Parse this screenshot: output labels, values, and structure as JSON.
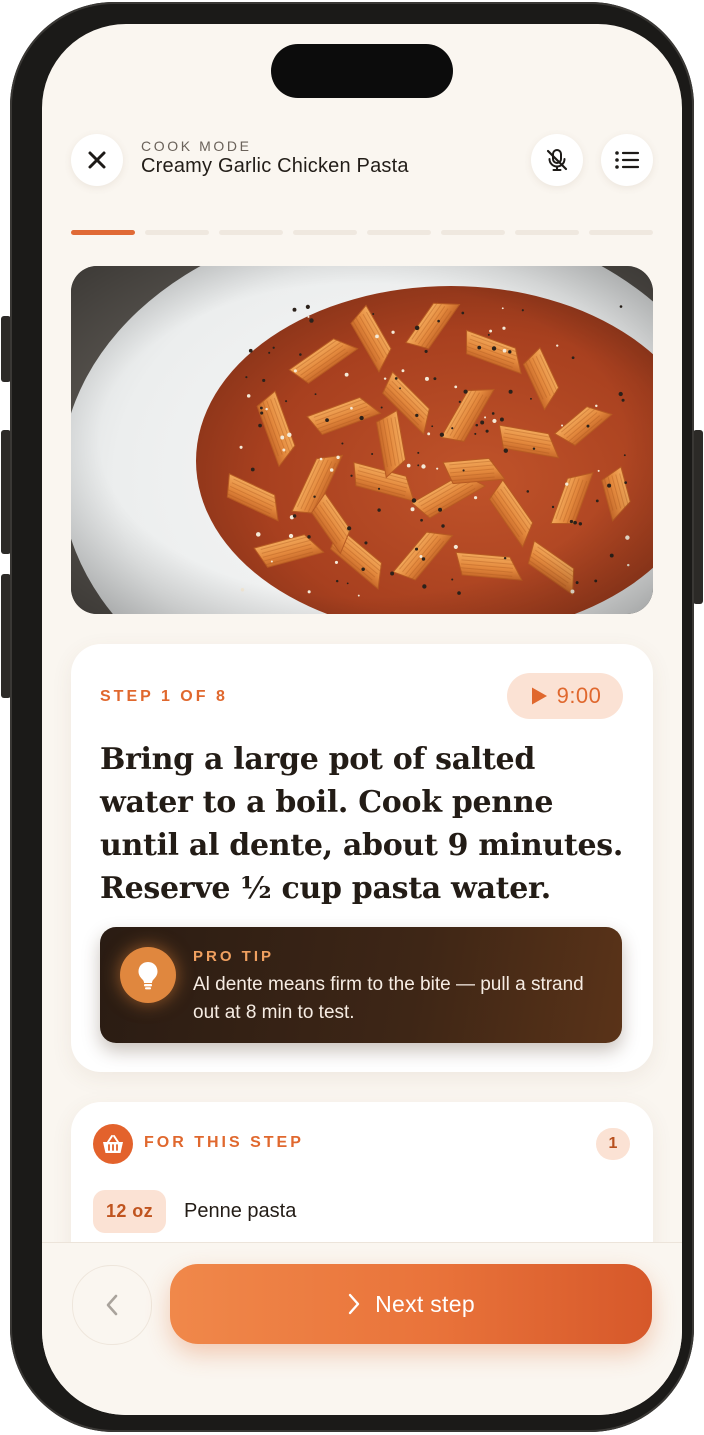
{
  "header": {
    "eyebrow": "COOK MODE",
    "recipe_title": "Creamy Garlic Chicken Pasta"
  },
  "progress": {
    "current_step": 1,
    "total_steps": 8
  },
  "step": {
    "label": "STEP 1 OF 8",
    "timer": "9:00",
    "instruction": "Bring a large pot of salted water to a boil. Cook penne until al dente, about 9 minutes. Reserve ½ cup pasta water.",
    "tip": {
      "label": "PRO TIP",
      "text": "Al dente means firm to the bite — pull a strand out at 8 min to test."
    }
  },
  "ingredients": {
    "label": "FOR THIS STEP",
    "count": "1",
    "items": [
      {
        "qty": "12 oz",
        "name": "Penne pasta"
      }
    ]
  },
  "actions": {
    "next_label": "Next step"
  },
  "icons": {
    "close": "close-icon",
    "mic_off": "mic-off-icon",
    "steps_list": "list-icon",
    "play": "play-icon",
    "bulb": "lightbulb-icon",
    "basket": "basket-icon",
    "prev": "chevron-left-icon",
    "next": "chevron-right-icon"
  },
  "colors": {
    "accent": "#e0682e",
    "background": "#faf6f0",
    "accent_soft": "#fbe2d4",
    "tip_dark": "#3e2616"
  }
}
